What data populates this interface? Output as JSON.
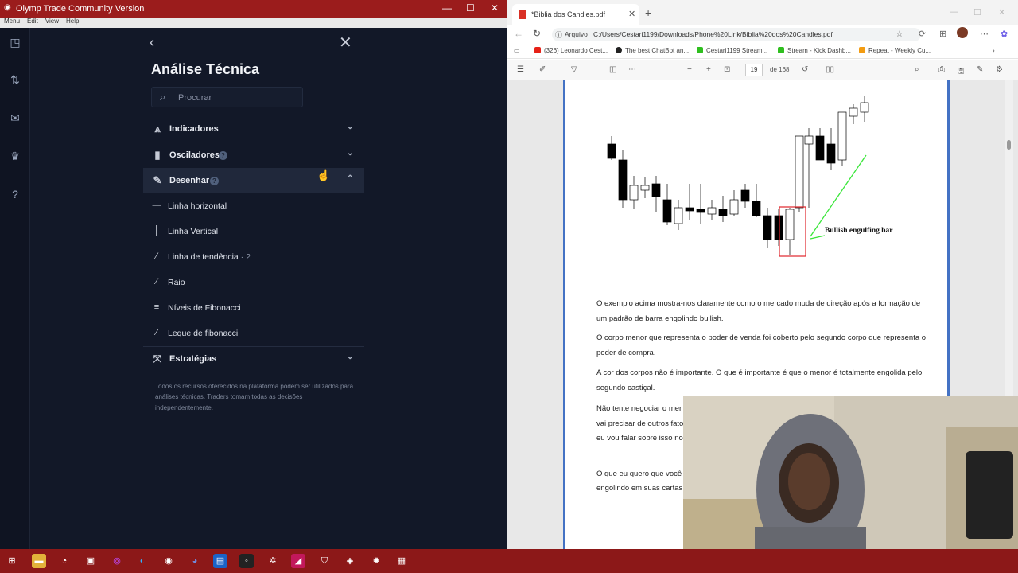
{
  "left_app": {
    "window_title": "Olymp Trade Community Version",
    "menu": [
      "Menu",
      "Edit",
      "View",
      "Help"
    ],
    "panel": {
      "title": "Análise Técnica",
      "search_placeholder": "Procurar",
      "sections": [
        {
          "label": "Indicadores",
          "icon": "indicators-icon",
          "expanded": false
        },
        {
          "label": "Osciladores",
          "icon": "bar-chart-icon",
          "expanded": false,
          "help": "?"
        },
        {
          "label": "Desenhar",
          "icon": "pencil-icon",
          "expanded": true,
          "help": "?"
        }
      ],
      "draw_items": [
        {
          "label": "Linha horizontal",
          "icon": "horizontal-line-icon"
        },
        {
          "label": "Linha Vertical",
          "icon": "vertical-line-icon"
        },
        {
          "label": "Linha de tendência",
          "count": "· 2",
          "icon": "trend-line-icon"
        },
        {
          "label": "Raio",
          "icon": "ray-icon"
        },
        {
          "label": "Níveis de Fibonacci",
          "icon": "fibonacci-levels-icon"
        },
        {
          "label": "Leque de fibonacci",
          "icon": "fibonacci-fan-icon"
        }
      ],
      "strategies": {
        "label": "Estratégias",
        "icon": "strategy-icon"
      },
      "disclaimer": "Todos os recursos oferecidos na plataforma podem ser utilizados para análises técnicas. Traders tomam todas as decisões independentemente."
    }
  },
  "browser": {
    "tab_title": "*Biblia dos Candles.pdf",
    "address_label": "Arquivo",
    "address_path": "C:/Users/Cestari1199/Downloads/Phone%20Link/Biblia%20dos%20Candles.pdf",
    "bookmarks": [
      "(326) Leonardo Cest...",
      "The best ChatBot an...",
      "Cestari1199 Stream...",
      "Stream - Kick Dashb...",
      "Repeat - Weekly Cu..."
    ],
    "pdf_page": "19",
    "pdf_page_of": "de 168",
    "chart_label": "Bullish engulfing bar",
    "paragraphs": [
      "O exemplo acima mostra-nos claramente como o mercado muda de direção após a formação de um padrão de barra engolindo bullish.",
      "O corpo menor que representa o poder de venda foi coberto pelo segundo corpo que representa o poder de compra.",
      "A cor dos corpos não é importante. O que é importante é que o menor é totalmente engolida pelo segundo castiçal.",
      "Não tente negociar o mer",
      "vai precisar de outros fato",
      "eu vou falar sobre isso no",
      "O que eu quero que você",
      "engolindo em suas cartas"
    ]
  },
  "colors": {
    "titlebar_red": "#9b1c1c",
    "panel_bg": "#121828",
    "pdf_border_blue": "#4472c4",
    "highlight_red": "#e0262b",
    "arrow_green": "#39e639"
  }
}
